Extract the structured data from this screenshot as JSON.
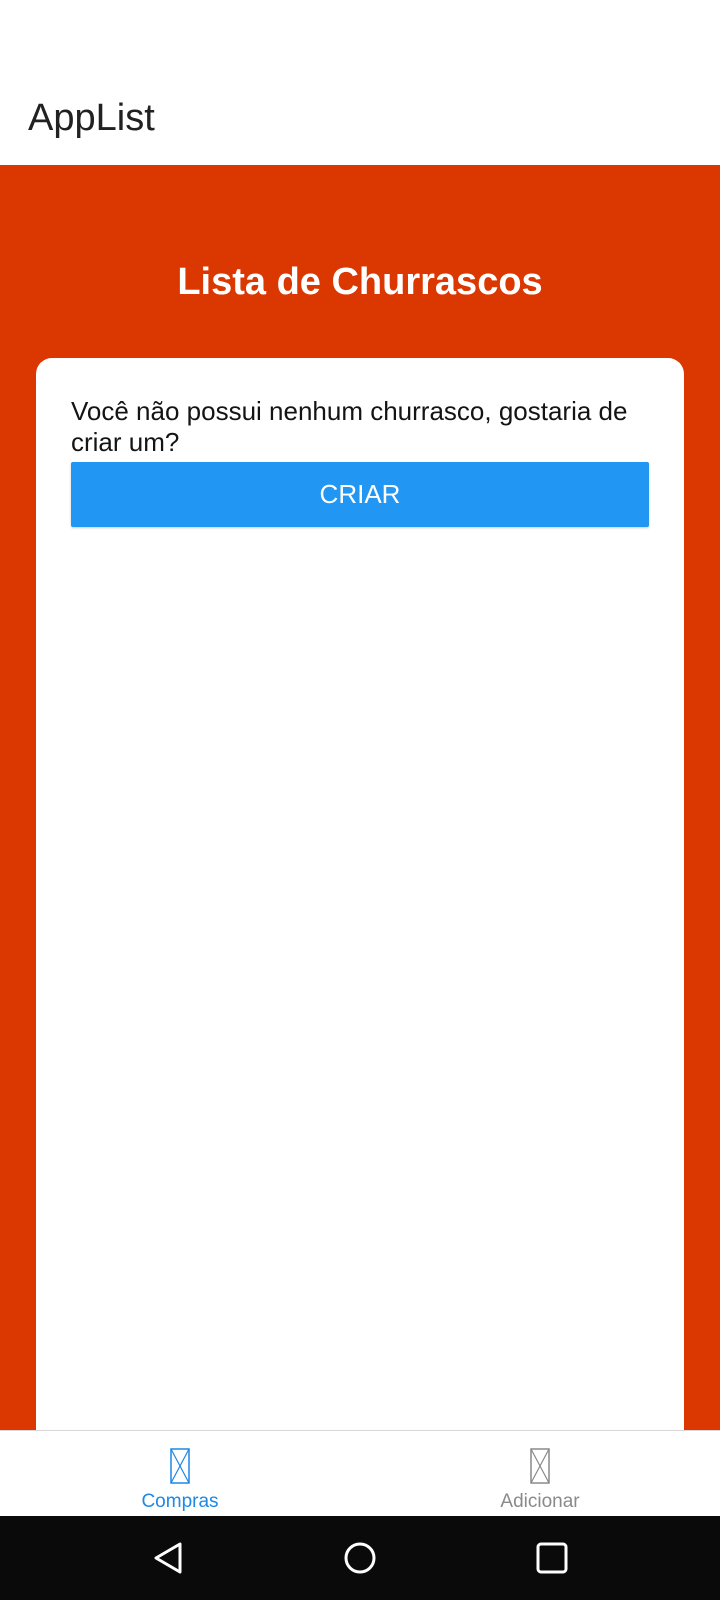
{
  "app": {
    "title": "AppList"
  },
  "page": {
    "title": "Lista de Churrascos",
    "background_color": "#db3700"
  },
  "empty_state": {
    "message": "Você não possui nenhum churrasco, gostaria de criar um?",
    "button_label": "CRIAR",
    "button_color": "#2196f3"
  },
  "tabs": [
    {
      "label": "Compras",
      "icon": "placeholder-icon",
      "active": true,
      "color": "#1e88e5"
    },
    {
      "label": "Adicionar",
      "icon": "placeholder-icon",
      "active": false,
      "color": "#8a8a8a"
    }
  ],
  "system_nav": {
    "buttons": [
      "back-icon",
      "home-icon",
      "recents-icon"
    ]
  }
}
